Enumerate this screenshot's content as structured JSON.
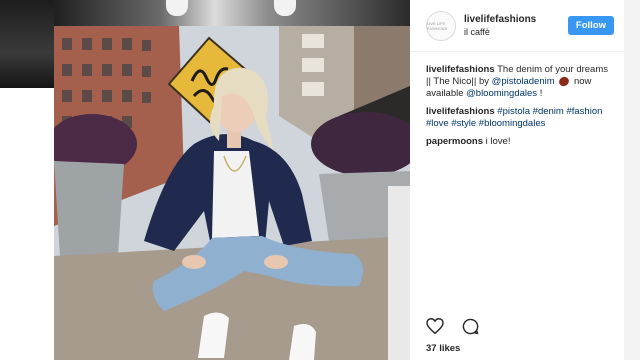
{
  "post": {
    "username": "livelifefashions",
    "location": "il caffè",
    "follow_label": "Follow",
    "avatar_text": "LIVE LIFE FASHIONS",
    "caption": {
      "author": "livelifefashions",
      "text_1": "The denim of your dreams || The Nico|| by ",
      "mention_1": "@pistoladenim",
      "text_2": " now available ",
      "mention_2": "@bloomingdales",
      "text_3": " !"
    },
    "tags_comment": {
      "author": "livelifefashions",
      "tags": "#pistola #denim #fashion #love #style #bloomingdales"
    },
    "reply": {
      "author": "papermoons",
      "text": "i love!"
    },
    "likes": "37 likes"
  },
  "colors": {
    "follow_blue": "#3897f0",
    "link_blue": "#003569",
    "text_dark": "#262626"
  },
  "icons": [
    "heart-icon",
    "comment-icon"
  ]
}
